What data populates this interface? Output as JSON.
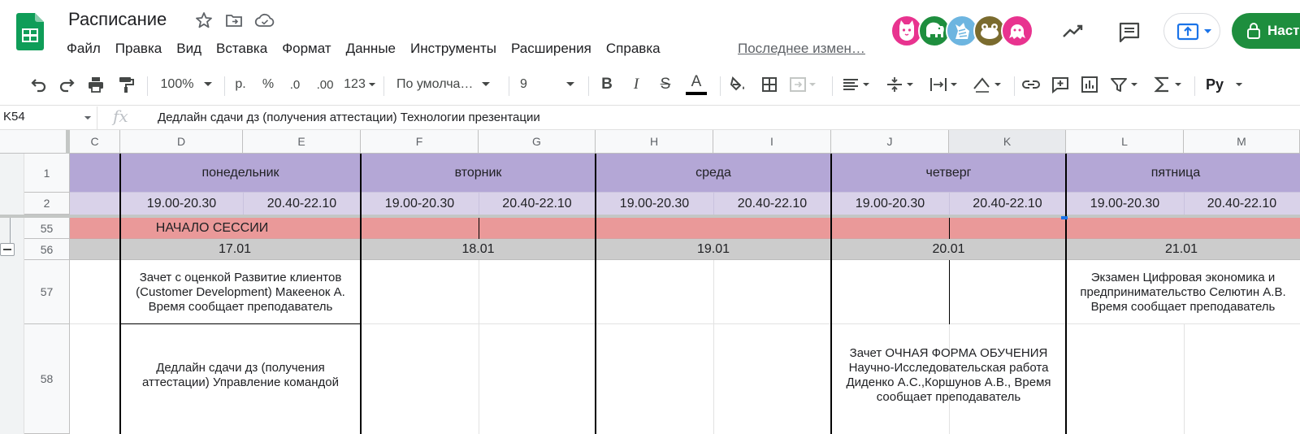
{
  "app": {
    "doc_title": "Расписание",
    "menu": [
      "Файл",
      "Правка",
      "Вид",
      "Вставка",
      "Формат",
      "Данные",
      "Инструменты",
      "Расширения",
      "Справка"
    ],
    "last_edit": "Последнее измен…",
    "share_label": "Наст",
    "brand_color": "#0f9d58",
    "avatars": [
      {
        "icon": "cat-avatar-icon",
        "color": "#e8338f"
      },
      {
        "icon": "elephant-avatar-icon",
        "color": "#1e8e3e"
      },
      {
        "icon": "zebra-avatar-icon",
        "color": "#6db5e0"
      },
      {
        "icon": "frog-avatar-icon",
        "color": "#7a6b2e"
      },
      {
        "icon": "octopus-avatar-icon",
        "color": "#e8338f"
      }
    ]
  },
  "toolbar": {
    "zoom": "100%",
    "currency": "р.",
    "percent": "%",
    "decrease_decimal": ".0",
    "increase_decimal": ".00",
    "more_formats": "123",
    "font": "По умолча…",
    "font_size": "9",
    "bold": "B",
    "italic": "I",
    "strike": "S",
    "text_color": "A",
    "input_tools": "Ру"
  },
  "formula_bar": {
    "name_box": "K54",
    "fx": "fx",
    "formula": "Дедлайн сдачи дз (получения аттестации) Технологии презентации"
  },
  "sheet": {
    "columns": [
      "C",
      "D",
      "E",
      "F",
      "G",
      "H",
      "I",
      "J",
      "K",
      "L",
      "M"
    ],
    "rows": [
      "1",
      "2",
      "55",
      "56",
      "57",
      "58"
    ],
    "days": [
      "понедельник",
      "вторник",
      "среда",
      "четверг",
      "пятница"
    ],
    "times": [
      "19.00-20.30",
      "20.40-22.10",
      "19.00-20.30",
      "20.40-22.10",
      "19.00-20.30",
      "20.40-22.10",
      "19.00-20.30",
      "20.40-22.10",
      "19.00-20.30",
      "20.40-22.10"
    ],
    "session_start": "НАЧАЛО СЕССИИ",
    "dates": [
      "17.01",
      "18.01",
      "19.01",
      "20.01",
      "21.01"
    ],
    "row57_monday": "Зачет с оценкой Развитие клиентов (Customer Development) Макеенок А. Время сообщает преподаватель",
    "row57_friday": "Экзамен Цифровая экономика и предпринимательство Селютин А.В. Время сообщает преподаватель",
    "row58_monday": "Дедлайн сдачи дз (получения аттестации) Управление командой",
    "row58_thursday": "Зачет ОЧНАЯ ФОРМА ОБУЧЕНИЯ Научно-Исследовательская работа Диденко А.С.,Коршунов А.В., Время сообщает преподаватель",
    "colors": {
      "day_header": "#b4a7d6",
      "time_header": "#d9d2e9",
      "session_row": "#ea9999",
      "date_row": "#cccccc"
    }
  }
}
